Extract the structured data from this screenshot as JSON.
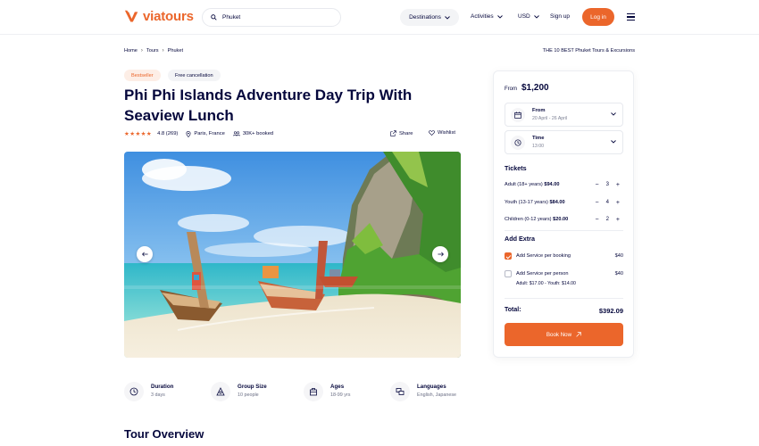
{
  "header": {
    "logo_text": "viatours",
    "search_value": "Phuket",
    "nav_destinations": "Destinations",
    "nav_activities": "Activities",
    "currency": "USD",
    "signup": "Sign up",
    "login": "Log in"
  },
  "breadcrumb": {
    "items": [
      "Home",
      "Tours",
      "Phuket"
    ],
    "right_text": "THE 10 BEST Phuket Tours & Excursions"
  },
  "badges": {
    "bestseller": "Bestseller",
    "cancellation": "Free cancellation"
  },
  "tour": {
    "title": "Phi Phi Islands Adventure Day Trip With Seaview Lunch",
    "rating": "4.8 (269)",
    "location": "Paris, France",
    "booked": "30K+ booked",
    "share": "Share",
    "wishlist": "Wishlist"
  },
  "info": [
    {
      "label": "Duration",
      "value": "3 days",
      "icon": "clock-icon"
    },
    {
      "label": "Group Size",
      "value": "10 people",
      "icon": "group-icon"
    },
    {
      "label": "Ages",
      "value": "18-99 yrs",
      "icon": "ages-icon"
    },
    {
      "label": "Languages",
      "value": "English, Japanese",
      "icon": "language-icon"
    }
  ],
  "section": {
    "overview": "Tour Overview"
  },
  "booking": {
    "from_label": "From",
    "price": "$1,200",
    "date_label": "From",
    "date_value": "20 April - 26 April",
    "time_label": "Time",
    "time_value": "13:00",
    "tickets_title": "Tickets",
    "tickets": [
      {
        "label": "Adult (18+ years)",
        "price": "$94.00",
        "qty": "3"
      },
      {
        "label": "Youth (13-17 years)",
        "price": "$84.00",
        "qty": "4"
      },
      {
        "label": "Children (0-12 years)",
        "price": "$20.00",
        "qty": "2"
      }
    ],
    "extra_title": "Add Extra",
    "extras": [
      {
        "label": "Add Service per booking",
        "price": "$40",
        "checked": true
      },
      {
        "label": "Add Service per person",
        "price": "$40",
        "checked": false,
        "sub": "Adult: $17.00  -  Youth: $14.00"
      }
    ],
    "total_label": "Total:",
    "total_value": "$392.09",
    "book_button": "Book Now"
  },
  "colors": {
    "accent": "#eb662b",
    "text": "#05073c"
  }
}
